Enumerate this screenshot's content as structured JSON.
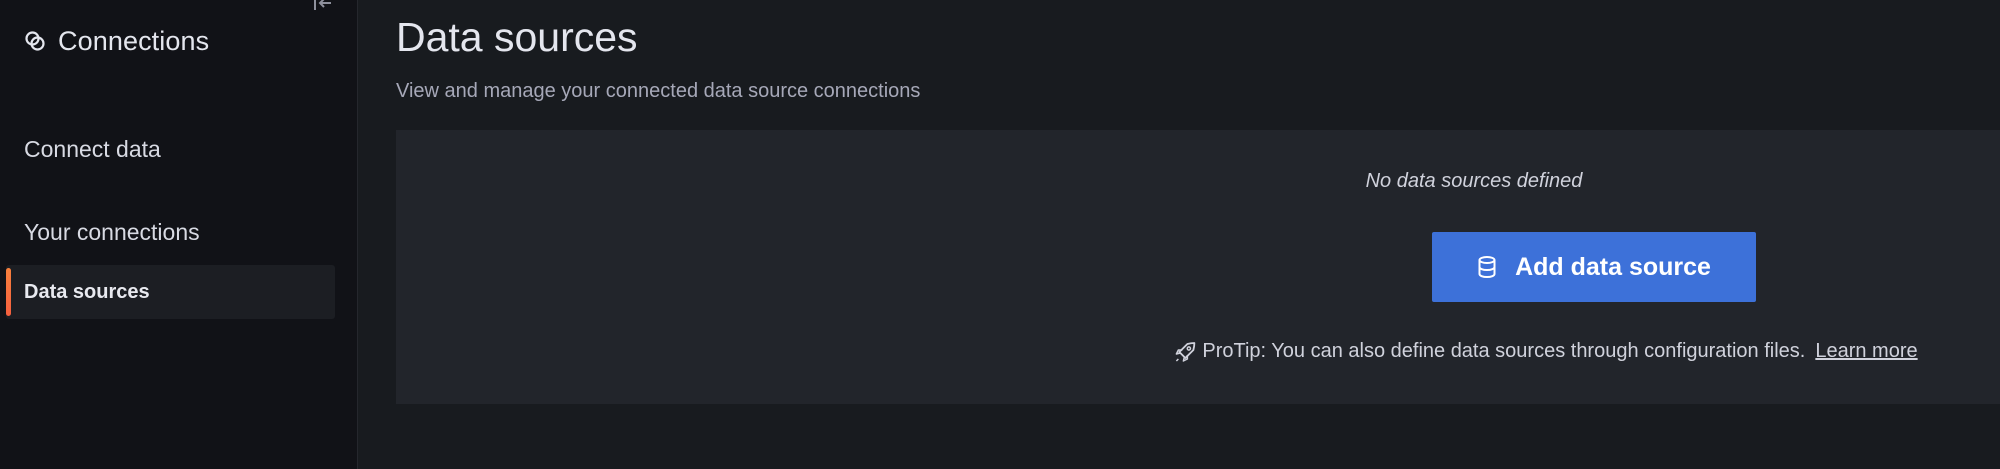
{
  "sidebar": {
    "title": "Connections",
    "sections": {
      "connect_data": "Connect data",
      "your_connections": "Your connections"
    },
    "active_item": "Data sources",
    "accent_color": "#f55f3e"
  },
  "main": {
    "title": "Data sources",
    "subtitle": "View and manage your connected data source connections",
    "empty_state": {
      "message": "No data sources defined",
      "button_label": "Add data source",
      "button_icon": "database-icon",
      "button_color": "#3d71d9",
      "protip_text": "ProTip: You can also define data sources through configuration files.",
      "protip_icon": "rocket-icon",
      "learn_more": "Learn more"
    }
  }
}
